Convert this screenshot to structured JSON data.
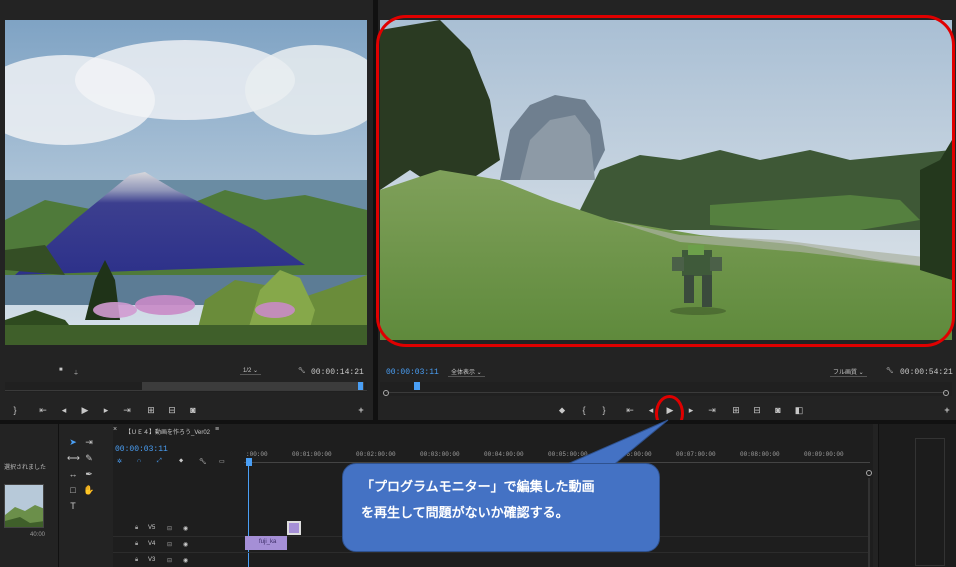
{
  "source_monitor": {
    "zoom": "1/2",
    "timecode": "00:00:14:21"
  },
  "program_monitor": {
    "timecode_current": "00:00:03:11",
    "fit_label": "全体表示",
    "quality_label": "フル画質",
    "timecode_duration": "00:00:54:21"
  },
  "timeline": {
    "sequence_name": "【ＵＥ４】動画を作ろう_Ver02",
    "current_timecode": "00:00:03:11",
    "ruler": [
      ":00:00",
      "00:01:00:00",
      "00:02:00:00",
      "00:03:00:00",
      "00:04:00:00",
      "00:05:00:00",
      "00:06:00:00",
      "00:07:00:00",
      "00:08:00:00",
      "00:09:00:00"
    ],
    "tracks": [
      "V5",
      "V4",
      "V3"
    ],
    "clip_label": "fuji_ka"
  },
  "project_panel": {
    "selected_text": "選択されました",
    "item_duration": "40:00"
  },
  "callout": {
    "text_line1": "「プログラムモニター」で編集した動画",
    "text_line2": "を再生して問題がないか確認する。"
  },
  "colors": {
    "highlight_red": "#e00000",
    "callout_blue": "#4472c4",
    "playhead_blue": "#4a9ff5",
    "clip_purple": "#a58fd6"
  }
}
